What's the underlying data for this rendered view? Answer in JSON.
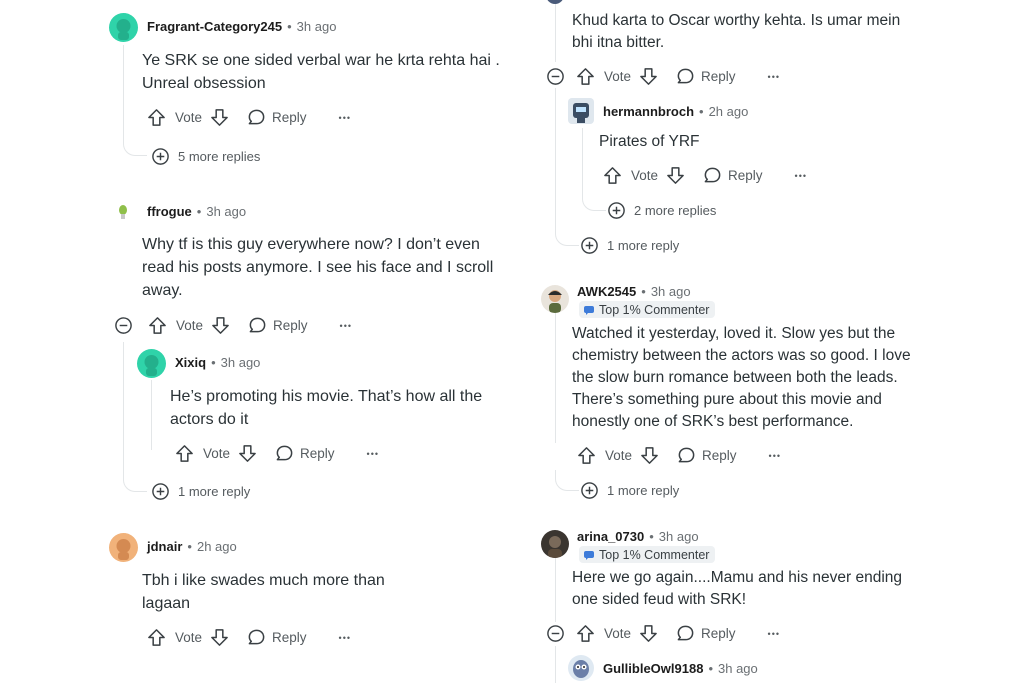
{
  "labels": {
    "vote": "Vote",
    "reply": "Reply",
    "more": "•••",
    "sep": "•"
  },
  "left": {
    "c1": {
      "author": "Fragrant-Category245",
      "time": "3h ago",
      "body": [
        "Ye SRK se one sided verbal war he krta rehta hai .",
        "Unreal obsession"
      ],
      "more_replies": "5 more replies"
    },
    "c2": {
      "author": "ffrogue",
      "time": "3h ago",
      "body": [
        "Why tf is this guy everywhere now? I don’t even",
        "read his posts anymore. I see his face and I scroll",
        "away."
      ],
      "reply": {
        "author": "Xixiq",
        "time": "3h ago",
        "body": [
          "He’s promoting his movie. That’s how all the",
          "actors do it"
        ]
      },
      "more_replies": "1 more reply"
    },
    "c3": {
      "author": "jdnair",
      "time": "2h ago",
      "body": [
        "Tbh i like swades much more than",
        "lagaan"
      ]
    }
  },
  "right": {
    "c1": {
      "body": [
        "Khud karta to Oscar worthy kehta. Is umar mein",
        "bhi itna bitter."
      ],
      "reply": {
        "author": "hermannbroch",
        "time": "2h ago",
        "body": "Pirates of YRF",
        "more_replies": "2 more replies"
      },
      "more_replies": "1 more reply"
    },
    "c2": {
      "author": "AWK2545",
      "time": "3h ago",
      "badge": "Top 1% Commenter",
      "body": [
        "Watched it yesterday, loved it. Slow yes but the",
        "chemistry between the actors was so good. I love",
        "the slow burn romance between both the leads.",
        "There’s something pure about this movie and",
        "honestly one of SRK’s best performance."
      ],
      "more_replies": "1 more reply"
    },
    "c3": {
      "author": "arina_0730",
      "time": "3h ago",
      "badge": "Top 1% Commenter",
      "body": [
        "Here we go again....Mamu and his never ending",
        "one sided feud with SRK!"
      ],
      "reply": {
        "author": "GullibleOwl9188",
        "time": "3h ago"
      }
    }
  },
  "colors": {
    "accent_teal": "#2fd3a9",
    "text": "#2a3236",
    "muted": "#6a6f73"
  }
}
